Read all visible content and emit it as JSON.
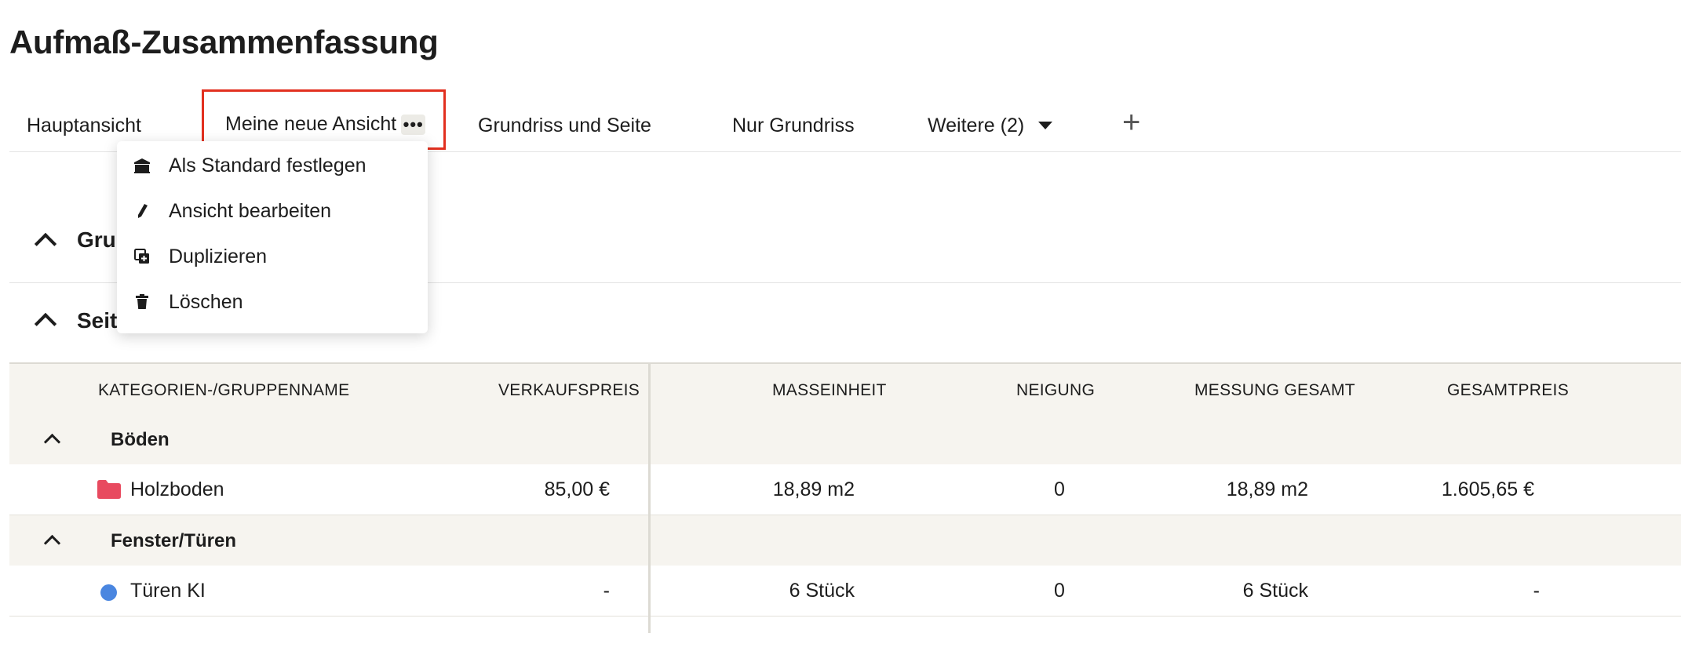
{
  "page": {
    "title": "Aufmaß-Zusammenfassung"
  },
  "tabs": [
    {
      "label": "Hauptansicht"
    },
    {
      "label": "Meine neue Ansicht",
      "more": "•••"
    },
    {
      "label": "Grundriss und Seite"
    },
    {
      "label": "Nur Grundriss"
    },
    {
      "label": "Weitere (2)"
    }
  ],
  "add_tab": {
    "symbol": "+"
  },
  "dropdown": {
    "items": [
      {
        "label": "Als Standard festlegen",
        "icon": "bank-icon"
      },
      {
        "label": "Ansicht bearbeiten",
        "icon": "pencil-icon"
      },
      {
        "label": "Duplizieren",
        "icon": "duplicate-icon"
      },
      {
        "label": "Löschen",
        "icon": "trash-icon"
      }
    ]
  },
  "sections": [
    {
      "title": "Grundriss"
    },
    {
      "title": "Seite"
    }
  ],
  "table": {
    "headers": [
      "KATEGORIEN-/GRUPPENNAME",
      "VERKAUFSPREIS",
      "MASSEINHEIT",
      "NEIGUNG",
      "MESSUNG GESAMT",
      "GESAMTPREIS"
    ],
    "groups": [
      {
        "name": "Böden",
        "rows": [
          {
            "name": "Holzboden",
            "icon": "folder-icon",
            "verkaufspreis": "85,00 €",
            "masseinheit": "18,89 m2",
            "neigung": "0",
            "messung": "18,89 m2",
            "gesamtpreis": "1.605,65 €"
          }
        ]
      },
      {
        "name": "Fenster/Türen",
        "rows": [
          {
            "name": "Türen KI",
            "icon": "dot-icon",
            "verkaufspreis": "-",
            "masseinheit": "6 Stück",
            "neigung": "0",
            "messung": "6 Stück",
            "gesamtpreis": "-"
          }
        ]
      }
    ]
  },
  "colors": {
    "highlight": "#e2301f",
    "folder": "#e84a5f",
    "dot": "#4a86e0",
    "header_bg": "#f6f4ef"
  }
}
